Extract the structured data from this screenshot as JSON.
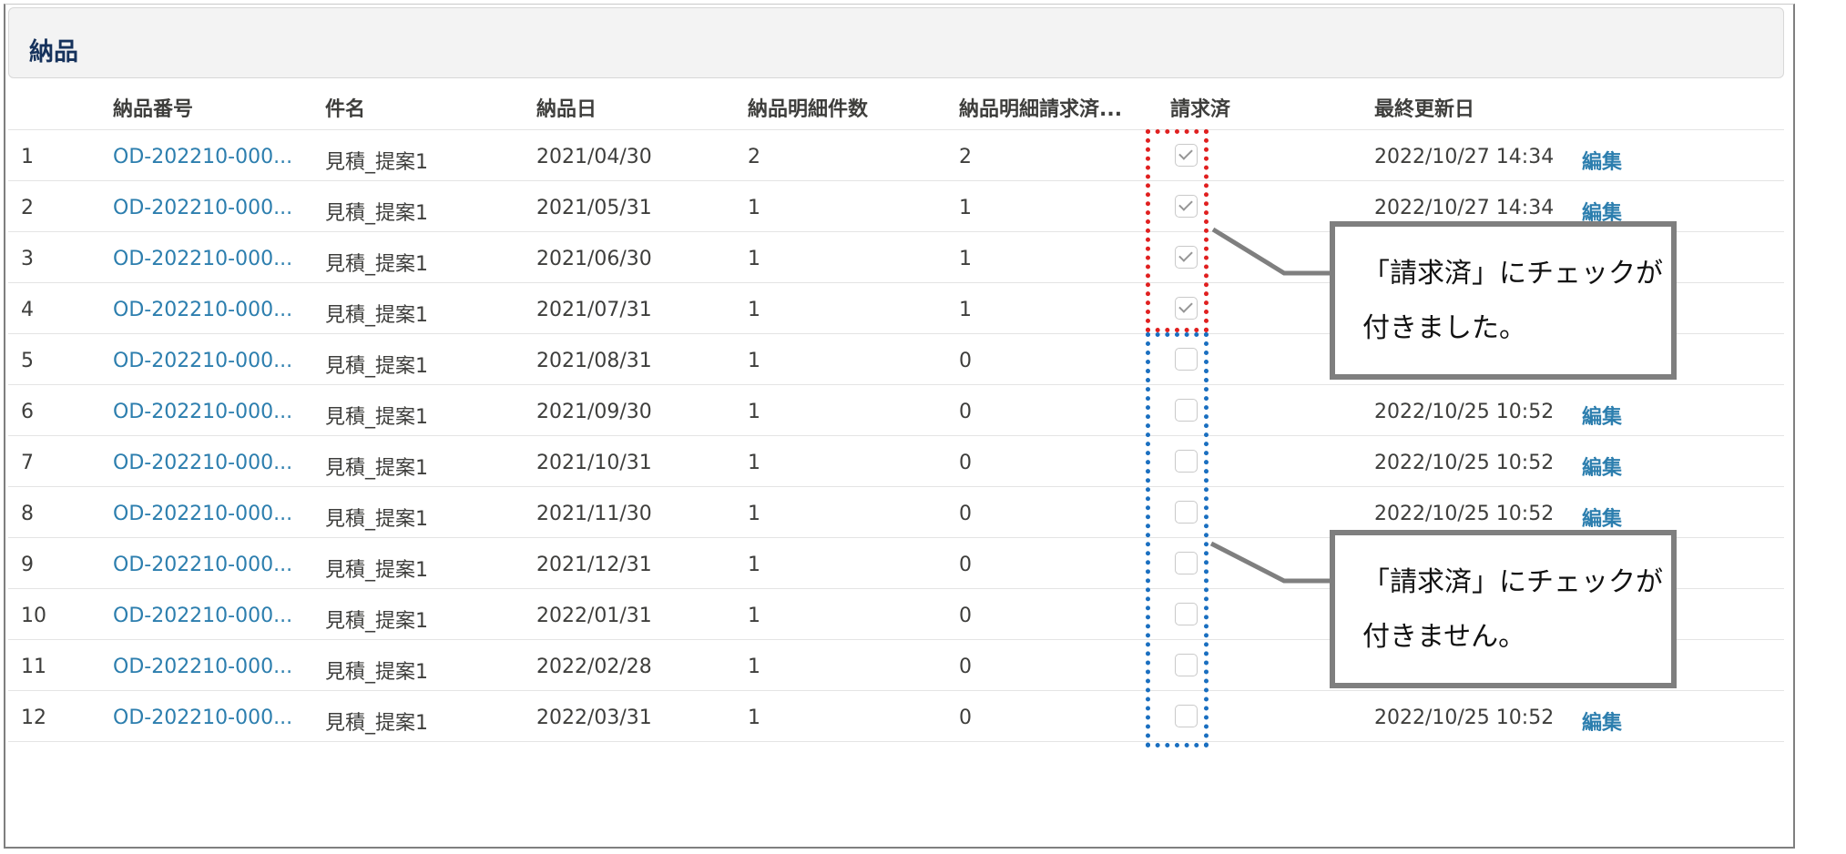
{
  "card": {
    "title": "納品"
  },
  "table": {
    "columns": [
      "納品番号",
      "件名",
      "納品日",
      "納品明細件数",
      "納品明細請求済...",
      "請求済",
      "最終更新日"
    ],
    "edit_label": "編集",
    "rows": [
      {
        "no": "1",
        "number": "OD-202210-000...",
        "subject": "見積_提案1",
        "date": "2021/04/30",
        "count": "2",
        "billed_count": "2",
        "billed": true,
        "updated": "2022/10/27 14:34",
        "edit": true
      },
      {
        "no": "2",
        "number": "OD-202210-000...",
        "subject": "見積_提案1",
        "date": "2021/05/31",
        "count": "1",
        "billed_count": "1",
        "billed": true,
        "updated": "2022/10/27 14:34",
        "edit": true
      },
      {
        "no": "3",
        "number": "OD-202210-000...",
        "subject": "見積_提案1",
        "date": "2021/06/30",
        "count": "1",
        "billed_count": "1",
        "billed": true,
        "updated": "",
        "edit": false
      },
      {
        "no": "4",
        "number": "OD-202210-000...",
        "subject": "見積_提案1",
        "date": "2021/07/31",
        "count": "1",
        "billed_count": "1",
        "billed": true,
        "updated": "",
        "edit": false
      },
      {
        "no": "5",
        "number": "OD-202210-000...",
        "subject": "見積_提案1",
        "date": "2021/08/31",
        "count": "1",
        "billed_count": "0",
        "billed": false,
        "updated": "",
        "edit": false
      },
      {
        "no": "6",
        "number": "OD-202210-000...",
        "subject": "見積_提案1",
        "date": "2021/09/30",
        "count": "1",
        "billed_count": "0",
        "billed": false,
        "updated": "2022/10/25 10:52",
        "edit": true
      },
      {
        "no": "7",
        "number": "OD-202210-000...",
        "subject": "見積_提案1",
        "date": "2021/10/31",
        "count": "1",
        "billed_count": "0",
        "billed": false,
        "updated": "2022/10/25 10:52",
        "edit": true
      },
      {
        "no": "8",
        "number": "OD-202210-000...",
        "subject": "見積_提案1",
        "date": "2021/11/30",
        "count": "1",
        "billed_count": "0",
        "billed": false,
        "updated": "2022/10/25 10:52",
        "edit": true
      },
      {
        "no": "9",
        "number": "OD-202210-000...",
        "subject": "見積_提案1",
        "date": "2021/12/31",
        "count": "1",
        "billed_count": "0",
        "billed": false,
        "updated": "",
        "edit": false
      },
      {
        "no": "10",
        "number": "OD-202210-000...",
        "subject": "見積_提案1",
        "date": "2022/01/31",
        "count": "1",
        "billed_count": "0",
        "billed": false,
        "updated": "",
        "edit": false
      },
      {
        "no": "11",
        "number": "OD-202210-000...",
        "subject": "見積_提案1",
        "date": "2022/02/28",
        "count": "1",
        "billed_count": "0",
        "billed": false,
        "updated": "",
        "edit": false
      },
      {
        "no": "12",
        "number": "OD-202210-000...",
        "subject": "見積_提案1",
        "date": "2022/03/31",
        "count": "1",
        "billed_count": "0",
        "billed": false,
        "updated": "2022/10/25 10:52",
        "edit": true
      }
    ]
  },
  "annotations": {
    "checked": {
      "line1": "「請求済」にチェックが",
      "line2": "付きました。",
      "color": "#e02020"
    },
    "unchecked": {
      "line1": "「請求済」にチェックが",
      "line2": "付きません。",
      "color": "#1a6fc0"
    }
  }
}
